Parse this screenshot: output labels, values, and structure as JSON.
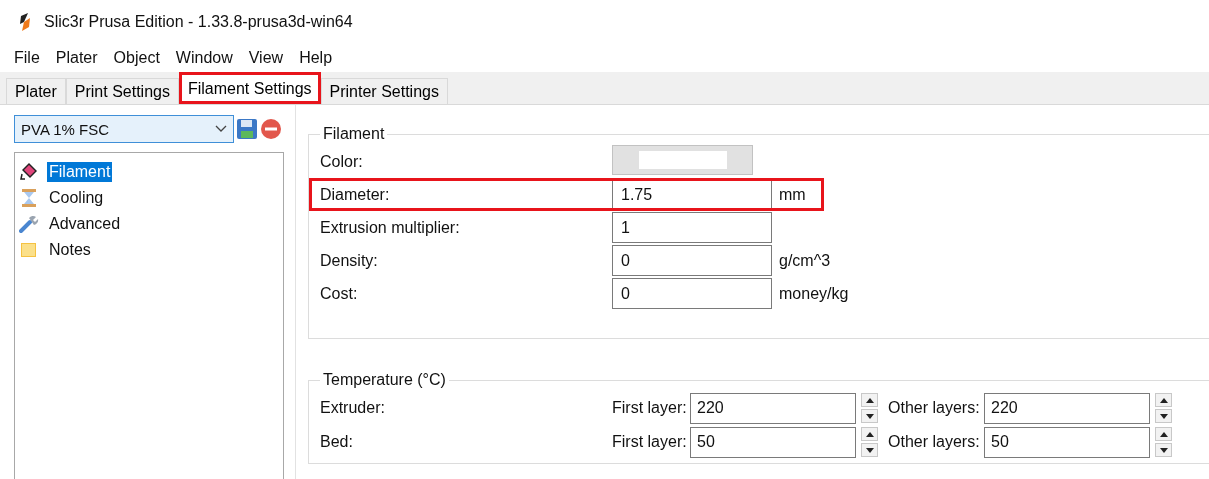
{
  "window": {
    "title": "Slic3r Prusa Edition - 1.33.8-prusa3d-win64"
  },
  "menu": [
    "File",
    "Plater",
    "Object",
    "Window",
    "View",
    "Help"
  ],
  "tabs": [
    {
      "label": "Plater",
      "selected": false,
      "highlighted": false
    },
    {
      "label": "Print Settings",
      "selected": false,
      "highlighted": false
    },
    {
      "label": "Filament Settings",
      "selected": true,
      "highlighted": true
    },
    {
      "label": "Printer Settings",
      "selected": false,
      "highlighted": false
    }
  ],
  "preset": {
    "value": "PVA 1% FSC"
  },
  "sidebar": {
    "items": [
      {
        "label": "Filament",
        "kind": "filament",
        "selected": true
      },
      {
        "label": "Cooling",
        "kind": "cooling",
        "selected": false
      },
      {
        "label": "Advanced",
        "kind": "advanced",
        "selected": false
      },
      {
        "label": "Notes",
        "kind": "notes",
        "selected": false
      }
    ]
  },
  "filament_group": {
    "title": "Filament",
    "fields": [
      {
        "kind": "color",
        "label": "Color:",
        "highlighted": false
      },
      {
        "kind": "number",
        "label": "Diameter:",
        "value": "1.75",
        "unit": "mm",
        "highlighted": true
      },
      {
        "kind": "number",
        "label": "Extrusion multiplier:",
        "value": "1",
        "highlighted": false
      },
      {
        "kind": "number",
        "label": "Density:",
        "value": "0",
        "unit": "g/cm^3",
        "highlighted": false
      },
      {
        "kind": "number",
        "label": "Cost:",
        "value": "0",
        "unit": "money/kg",
        "highlighted": false
      }
    ]
  },
  "temperature_group": {
    "title": "Temperature (°C)",
    "rows": [
      {
        "label": "Extruder:",
        "first_label": "First layer:",
        "first_value": "220",
        "other_label": "Other layers:",
        "other_value": "220"
      },
      {
        "label": "Bed:",
        "first_label": "First layer:",
        "first_value": "50",
        "other_label": "Other layers:",
        "other_value": "50"
      }
    ]
  }
}
